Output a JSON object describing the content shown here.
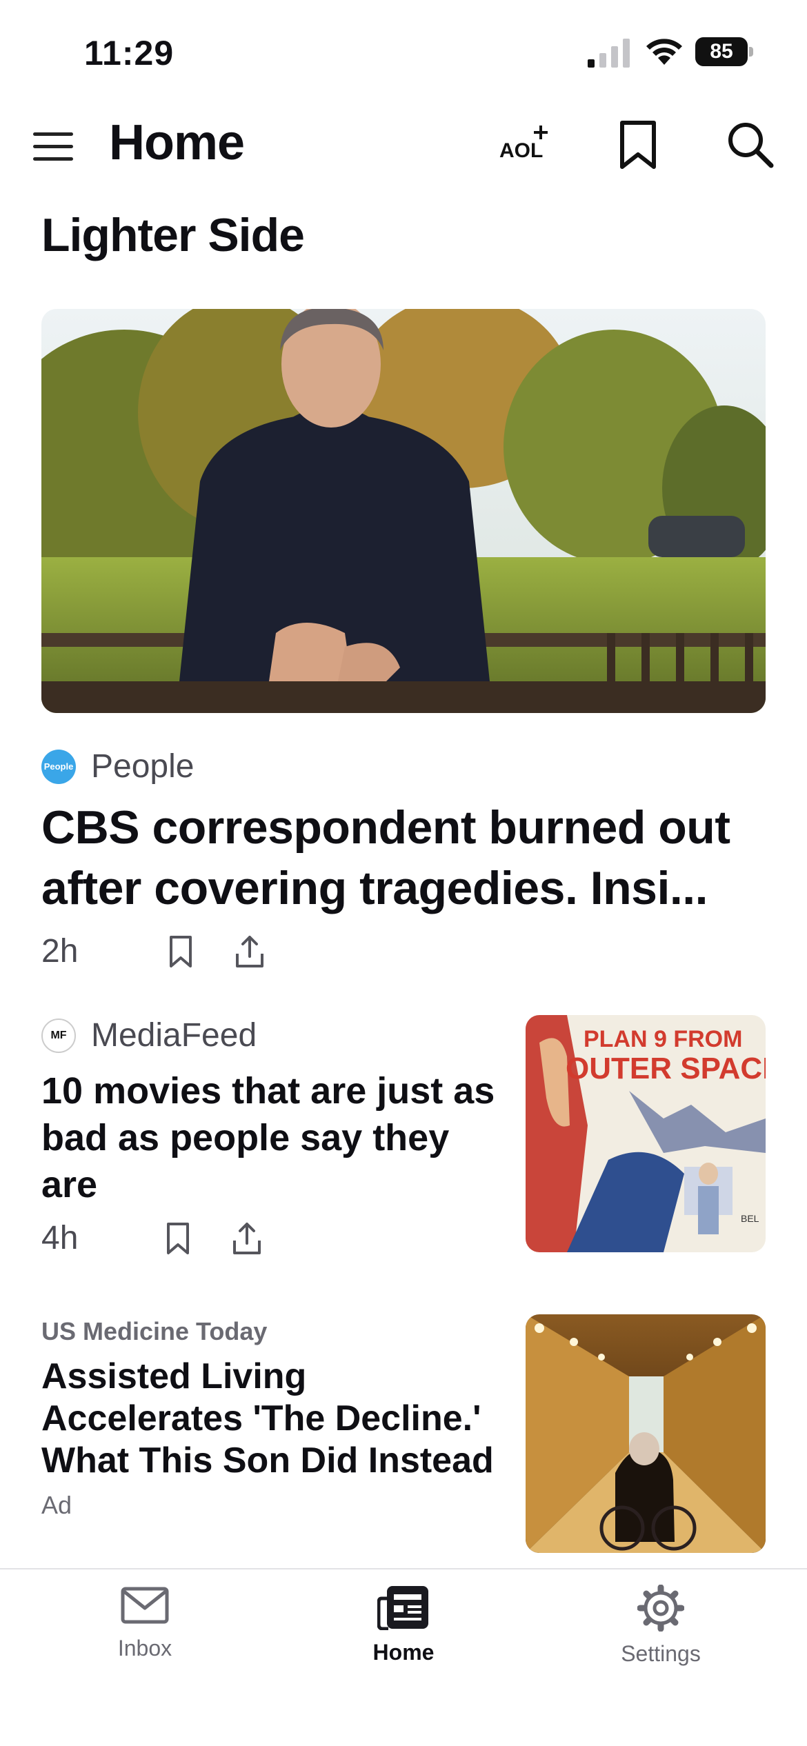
{
  "status_bar": {
    "time": "11:29",
    "battery": "85"
  },
  "header": {
    "title": "Home"
  },
  "section": {
    "title": "Lighter Side"
  },
  "hero": {
    "source": "People",
    "source_logo_text": "People",
    "headline": "CBS correspondent burned out after covering tragedies. Insi...",
    "time": "2h"
  },
  "card": {
    "source": "MediaFeed",
    "source_logo_text": "MF",
    "headline": "10 movies that are just as bad as people say they are",
    "time": "4h",
    "thumb_text_1": "PLAN 9 FROM",
    "thumb_text_2": "OUTER SPACE"
  },
  "ad": {
    "source": "US Medicine Today",
    "headline": "Assisted Living Accelerates 'The Decline.' What This Son Did Instead",
    "label": "Ad"
  },
  "tabs": [
    {
      "label": "Inbox",
      "icon": "mail-icon"
    },
    {
      "label": "Home",
      "icon": "news-icon"
    },
    {
      "label": "Settings",
      "icon": "gear-icon"
    }
  ],
  "colors": {
    "text": "#0f0f14",
    "muted": "#4a4a52",
    "people_logo": "#3aa6e8"
  }
}
